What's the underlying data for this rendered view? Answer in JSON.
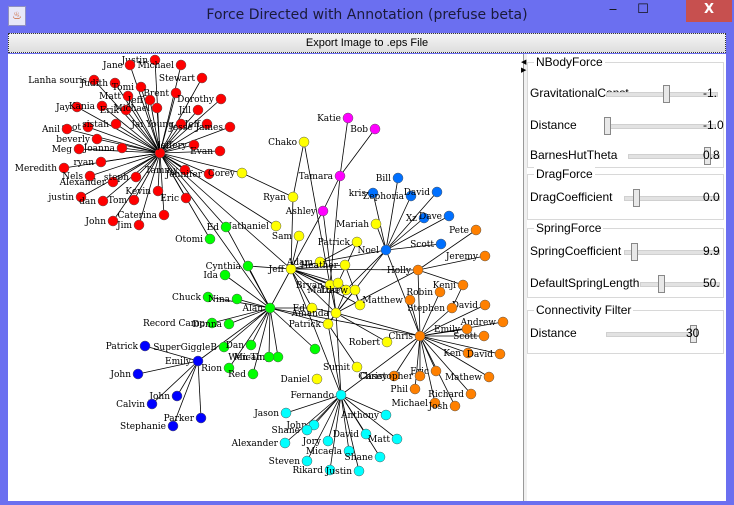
{
  "window": {
    "title": "Force Directed with Annotation (prefuse beta)",
    "icon": "java-cup-icon",
    "minimize": "‒",
    "maximize": "☐",
    "close": "X"
  },
  "toolbar": {
    "export_label": "Export Image to .eps File"
  },
  "panel": {
    "groups": [
      {
        "title": "NBodyForce",
        "rows": [
          {
            "label": "GravitationalConst...",
            "value": "-1.",
            "fraction": 0.55
          },
          {
            "label": "Distance",
            "value": "-1.0",
            "fraction": 0.0
          },
          {
            "label": "BarnesHutTheta",
            "value": "0.8",
            "fraction": 0.9
          }
        ]
      },
      {
        "title": "DragForce",
        "rows": [
          {
            "label": "DragCoefficient",
            "value": "0.0",
            "fraction": 0.1
          }
        ]
      },
      {
        "title": "SpringForce",
        "rows": [
          {
            "label": "SpringCoefficient",
            "value": "9.9",
            "fraction": 0.08
          },
          {
            "label": "DefaultSpringLength",
            "value": "50.",
            "fraction": 0.25
          }
        ]
      },
      {
        "title": "Connectivity Filter",
        "rows": [
          {
            "label": "Distance",
            "value": "30",
            "fraction": 1.0
          }
        ]
      }
    ]
  },
  "graph": {
    "colors": {
      "red": "#ff0000",
      "yellow": "#ffff00",
      "green": "#00ff00",
      "blue": "#0000ff",
      "orange": "#ff8000",
      "cyan": "#00ffff",
      "magenta": "#ff00ff",
      "lightblue": "#0070ff"
    },
    "nodes": [
      {
        "id": "hubR",
        "label": "",
        "group": "red"
      },
      {
        "id": "r1",
        "label": "Justin",
        "group": "red"
      },
      {
        "id": "r2",
        "label": "Jane",
        "group": "red"
      },
      {
        "id": "r3",
        "label": "Michael",
        "group": "red"
      },
      {
        "id": "r4",
        "label": "Lanha souris",
        "group": "red"
      },
      {
        "id": "r5",
        "label": "Judith",
        "group": "red"
      },
      {
        "id": "r6",
        "label": "Tomi",
        "group": "red"
      },
      {
        "id": "r7",
        "label": "Matt",
        "group": "red"
      },
      {
        "id": "r8",
        "label": "Stewart",
        "group": "red"
      },
      {
        "id": "r9",
        "label": "Brent",
        "group": "red"
      },
      {
        "id": "r10",
        "label": "Jay",
        "group": "red"
      },
      {
        "id": "r11",
        "label": "Kania",
        "group": "red"
      },
      {
        "id": "r12",
        "label": "Erik",
        "group": "red"
      },
      {
        "id": "r13",
        "label": "Michael",
        "group": "red"
      },
      {
        "id": "r14",
        "label": "Dorothy",
        "group": "red"
      },
      {
        "id": "r15",
        "label": "Jill",
        "group": "red"
      },
      {
        "id": "r16",
        "label": "spot",
        "group": "red"
      },
      {
        "id": "r17",
        "label": "sistah",
        "group": "red"
      },
      {
        "id": "r18",
        "label": "Jai Young",
        "group": "red"
      },
      {
        "id": "r19",
        "label": "Jeff",
        "group": "red"
      },
      {
        "id": "r20",
        "label": "Jesse James",
        "group": "red"
      },
      {
        "id": "r21",
        "label": "Anil",
        "group": "red"
      },
      {
        "id": "r22",
        "label": "beverly",
        "group": "red"
      },
      {
        "id": "r23",
        "label": "Meg",
        "group": "red"
      },
      {
        "id": "r24",
        "label": "Joanna",
        "group": "red"
      },
      {
        "id": "r25",
        "label": "Jeffery",
        "group": "red"
      },
      {
        "id": "r26",
        "label": "Evan",
        "group": "red"
      },
      {
        "id": "r27",
        "label": "Meredith",
        "group": "red"
      },
      {
        "id": "r28",
        "label": "ryan",
        "group": "red"
      },
      {
        "id": "r29",
        "label": "Nels",
        "group": "red"
      },
      {
        "id": "r30",
        "label": "Alexander",
        "group": "red"
      },
      {
        "id": "r31",
        "label": "steph",
        "group": "red"
      },
      {
        "id": "r32",
        "label": "Tammy",
        "group": "red"
      },
      {
        "id": "r33",
        "label": "Jennifer",
        "group": "red"
      },
      {
        "id": "r34",
        "label": "justin",
        "group": "red"
      },
      {
        "id": "r35",
        "label": "dan",
        "group": "red"
      },
      {
        "id": "r36",
        "label": "Tom",
        "group": "red"
      },
      {
        "id": "r37",
        "label": "Kevin",
        "group": "red"
      },
      {
        "id": "r38",
        "label": "Eric",
        "group": "red"
      },
      {
        "id": "r39",
        "label": "John",
        "group": "red"
      },
      {
        "id": "r40",
        "label": "Jim",
        "group": "red"
      },
      {
        "id": "r41",
        "label": "Caterina",
        "group": "red"
      },
      {
        "id": "r42",
        "label": "Jeff",
        "group": "red"
      },
      {
        "id": "y1",
        "label": "Corey",
        "group": "yellow"
      },
      {
        "id": "y2",
        "label": "Ryan",
        "group": "yellow"
      },
      {
        "id": "y3",
        "label": "Chako",
        "group": "yellow"
      },
      {
        "id": "y4",
        "label": "Nathaniel",
        "group": "yellow"
      },
      {
        "id": "y5",
        "label": "Sam",
        "group": "yellow"
      },
      {
        "id": "y6",
        "label": "Patrick",
        "group": "yellow"
      },
      {
        "id": "y7",
        "label": "Jeff",
        "group": "yellow"
      },
      {
        "id": "y8",
        "label": "Adam",
        "group": "yellow"
      },
      {
        "id": "y9",
        "label": "Heather",
        "group": "yellow"
      },
      {
        "id": "y10",
        "label": "Bryan",
        "group": "yellow"
      },
      {
        "id": "y11",
        "label": "Lori",
        "group": "yellow"
      },
      {
        "id": "y12",
        "label": "Ed",
        "group": "yellow"
      },
      {
        "id": "y13",
        "label": "Amanda",
        "group": "yellow"
      },
      {
        "id": "y14",
        "label": "Patrick",
        "group": "yellow"
      },
      {
        "id": "y15",
        "label": "Robert",
        "group": "yellow"
      },
      {
        "id": "y16",
        "label": "Sumit",
        "group": "yellow"
      },
      {
        "id": "y17",
        "label": "Daniel",
        "group": "yellow"
      },
      {
        "id": "y18",
        "label": "Mariah",
        "group": "yellow"
      },
      {
        "id": "y19",
        "label": "",
        "group": "yellow"
      },
      {
        "id": "y20",
        "label": "",
        "group": "yellow"
      },
      {
        "id": "y21",
        "label": "Matthew",
        "group": "yellow"
      },
      {
        "id": "m1",
        "label": "Katie",
        "group": "magenta"
      },
      {
        "id": "m2",
        "label": "Bob",
        "group": "magenta"
      },
      {
        "id": "m3",
        "label": "Tamara",
        "group": "magenta"
      },
      {
        "id": "m4",
        "label": "Ashley",
        "group": "magenta"
      },
      {
        "id": "g1",
        "label": "Ed",
        "group": "green"
      },
      {
        "id": "g2",
        "label": "Otomi",
        "group": "green"
      },
      {
        "id": "g3",
        "label": "Cynthia",
        "group": "green"
      },
      {
        "id": "g4",
        "label": "Ida",
        "group": "green"
      },
      {
        "id": "g5",
        "label": "Chuck",
        "group": "green"
      },
      {
        "id": "g6",
        "label": "Nina",
        "group": "green"
      },
      {
        "id": "g7",
        "label": "Alan",
        "group": "green"
      },
      {
        "id": "g8",
        "label": "Record Camp",
        "group": "green"
      },
      {
        "id": "g9",
        "label": "Donna",
        "group": "green"
      },
      {
        "id": "g10",
        "label": "SuperGiggleB",
        "group": "green"
      },
      {
        "id": "g11",
        "label": "Dan",
        "group": "green"
      },
      {
        "id": "g12",
        "label": "Wen-Ting",
        "group": "green"
      },
      {
        "id": "g13",
        "label": "Micah",
        "group": "green"
      },
      {
        "id": "g14",
        "label": "Rion",
        "group": "green"
      },
      {
        "id": "g15",
        "label": "Red",
        "group": "green"
      },
      {
        "id": "g16",
        "label": "",
        "group": "green"
      },
      {
        "id": "b1",
        "label": "Emily",
        "group": "blue"
      },
      {
        "id": "b2",
        "label": "Patrick",
        "group": "blue"
      },
      {
        "id": "b3",
        "label": "John",
        "group": "blue"
      },
      {
        "id": "b4",
        "label": "John",
        "group": "blue"
      },
      {
        "id": "b5",
        "label": "Calvin",
        "group": "blue"
      },
      {
        "id": "b6",
        "label": "Parker",
        "group": "blue"
      },
      {
        "id": "b7",
        "label": "Stephanie",
        "group": "blue"
      },
      {
        "id": "lb1",
        "label": "Noel",
        "group": "lightblue"
      },
      {
        "id": "lb2",
        "label": "Bill",
        "group": "lightblue"
      },
      {
        "id": "lb3",
        "label": "kris",
        "group": "lightblue"
      },
      {
        "id": "lb4",
        "label": "Zephoria",
        "group": "lightblue"
      },
      {
        "id": "lb5",
        "label": "David",
        "group": "lightblue"
      },
      {
        "id": "lb6",
        "label": "Xz",
        "group": "lightblue"
      },
      {
        "id": "lb7",
        "label": "Dave",
        "group": "lightblue"
      },
      {
        "id": "lb8",
        "label": "Scott",
        "group": "lightblue"
      },
      {
        "id": "o1",
        "label": "Chris",
        "group": "orange"
      },
      {
        "id": "o2",
        "label": "Holly",
        "group": "orange"
      },
      {
        "id": "o3",
        "label": "Pete",
        "group": "orange"
      },
      {
        "id": "o4",
        "label": "Jeremy",
        "group": "orange"
      },
      {
        "id": "o5",
        "label": "Kenji",
        "group": "orange"
      },
      {
        "id": "o6",
        "label": "Robin",
        "group": "orange"
      },
      {
        "id": "o7",
        "label": "David",
        "group": "orange"
      },
      {
        "id": "o8",
        "label": "Stephen",
        "group": "orange"
      },
      {
        "id": "o9",
        "label": "Matthew",
        "group": "orange"
      },
      {
        "id": "o10",
        "label": "Andrew",
        "group": "orange"
      },
      {
        "id": "o11",
        "label": "Emily",
        "group": "orange"
      },
      {
        "id": "o12",
        "label": "Scott",
        "group": "orange"
      },
      {
        "id": "o13",
        "label": "Ken",
        "group": "orange"
      },
      {
        "id": "o14",
        "label": "David",
        "group": "orange"
      },
      {
        "id": "o15",
        "label": "Casey",
        "group": "orange"
      },
      {
        "id": "o16",
        "label": "Eric",
        "group": "orange"
      },
      {
        "id": "o17",
        "label": "Christopher",
        "group": "orange"
      },
      {
        "id": "o18",
        "label": "Mathew",
        "group": "orange"
      },
      {
        "id": "o19",
        "label": "Phil",
        "group": "orange"
      },
      {
        "id": "o20",
        "label": "Richard",
        "group": "orange"
      },
      {
        "id": "o21",
        "label": "Michael",
        "group": "orange"
      },
      {
        "id": "o22",
        "label": "Josh",
        "group": "orange"
      },
      {
        "id": "c1",
        "label": "Fernando",
        "group": "cyan"
      },
      {
        "id": "c2",
        "label": "Jason",
        "group": "cyan"
      },
      {
        "id": "c3",
        "label": "John",
        "group": "cyan"
      },
      {
        "id": "c4",
        "label": "Anthony",
        "group": "cyan"
      },
      {
        "id": "c5",
        "label": "Shane",
        "group": "cyan"
      },
      {
        "id": "c6",
        "label": "Alexander",
        "group": "cyan"
      },
      {
        "id": "c7",
        "label": "Jory",
        "group": "cyan"
      },
      {
        "id": "c8",
        "label": "David",
        "group": "cyan"
      },
      {
        "id": "c9",
        "label": "Matt",
        "group": "cyan"
      },
      {
        "id": "c10",
        "label": "Micaela",
        "group": "cyan"
      },
      {
        "id": "c11",
        "label": "Shane",
        "group": "cyan"
      },
      {
        "id": "c12",
        "label": "Steven",
        "group": "cyan"
      },
      {
        "id": "c13",
        "label": "Rikard",
        "group": "cyan"
      },
      {
        "id": "c14",
        "label": "Justin",
        "group": "cyan"
      }
    ]
  }
}
